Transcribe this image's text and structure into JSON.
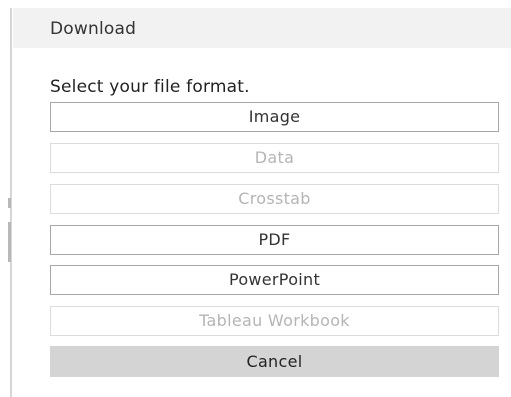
{
  "dialog": {
    "title": "Download",
    "prompt": "Select your file format."
  },
  "formats": [
    {
      "label": "Image",
      "enabled": true
    },
    {
      "label": "Data",
      "enabled": false
    },
    {
      "label": "Crosstab",
      "enabled": false
    },
    {
      "label": "PDF",
      "enabled": true
    },
    {
      "label": "PowerPoint",
      "enabled": true
    },
    {
      "label": "Tableau Workbook",
      "enabled": false
    }
  ],
  "cancel_label": "Cancel",
  "colors": {
    "header_bg": "#f2f2f2",
    "enabled_border": "#a7a7a7",
    "disabled_text": "#b5b5b5",
    "cancel_bg": "#d4d4d4"
  }
}
